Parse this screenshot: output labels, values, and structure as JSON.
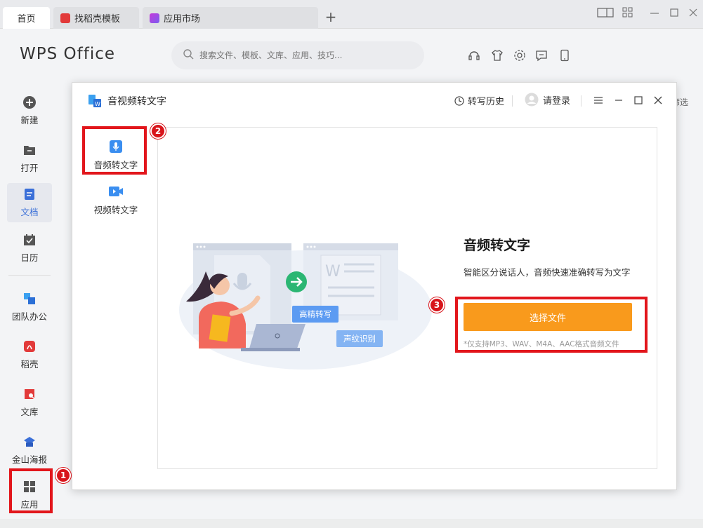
{
  "tabs": {
    "home": "首页",
    "template": "找稻壳模板",
    "appstore": "应用市场",
    "new_tab": "+"
  },
  "header": {
    "brand": "WPS Office",
    "search_placeholder": "搜索文件、模板、文库、应用、技巧..."
  },
  "sidebar": {
    "items": [
      {
        "label": "新建"
      },
      {
        "label": "打开"
      },
      {
        "label": "文档"
      },
      {
        "label": "日历"
      },
      {
        "label": "团队办公"
      },
      {
        "label": "稻壳"
      },
      {
        "label": "文库"
      },
      {
        "label": "金山海报"
      },
      {
        "label": "应用"
      }
    ]
  },
  "background_edge_text": "筛选",
  "dialog": {
    "title": "音视频转文字",
    "history": "转写历史",
    "login": "请登录",
    "modes": [
      {
        "label": "音频转文字"
      },
      {
        "label": "视频转文字"
      }
    ],
    "illustration": {
      "tag1": "高精转写",
      "tag2": "声纹识别"
    },
    "headline": "音频转文字",
    "subline": "智能区分说话人，音频快速准确转写为文字",
    "button": "选择文件",
    "note": "*仅支持MP3、WAV、M4A、AAC格式音频文件"
  },
  "annotations": {
    "badge1": "1",
    "badge2": "2",
    "badge3": "3",
    "color": "#e2161c"
  },
  "colors": {
    "accent_blue": "#3a6fd8",
    "button_orange": "#f99a1c",
    "arrow_green": "#2bb673"
  }
}
